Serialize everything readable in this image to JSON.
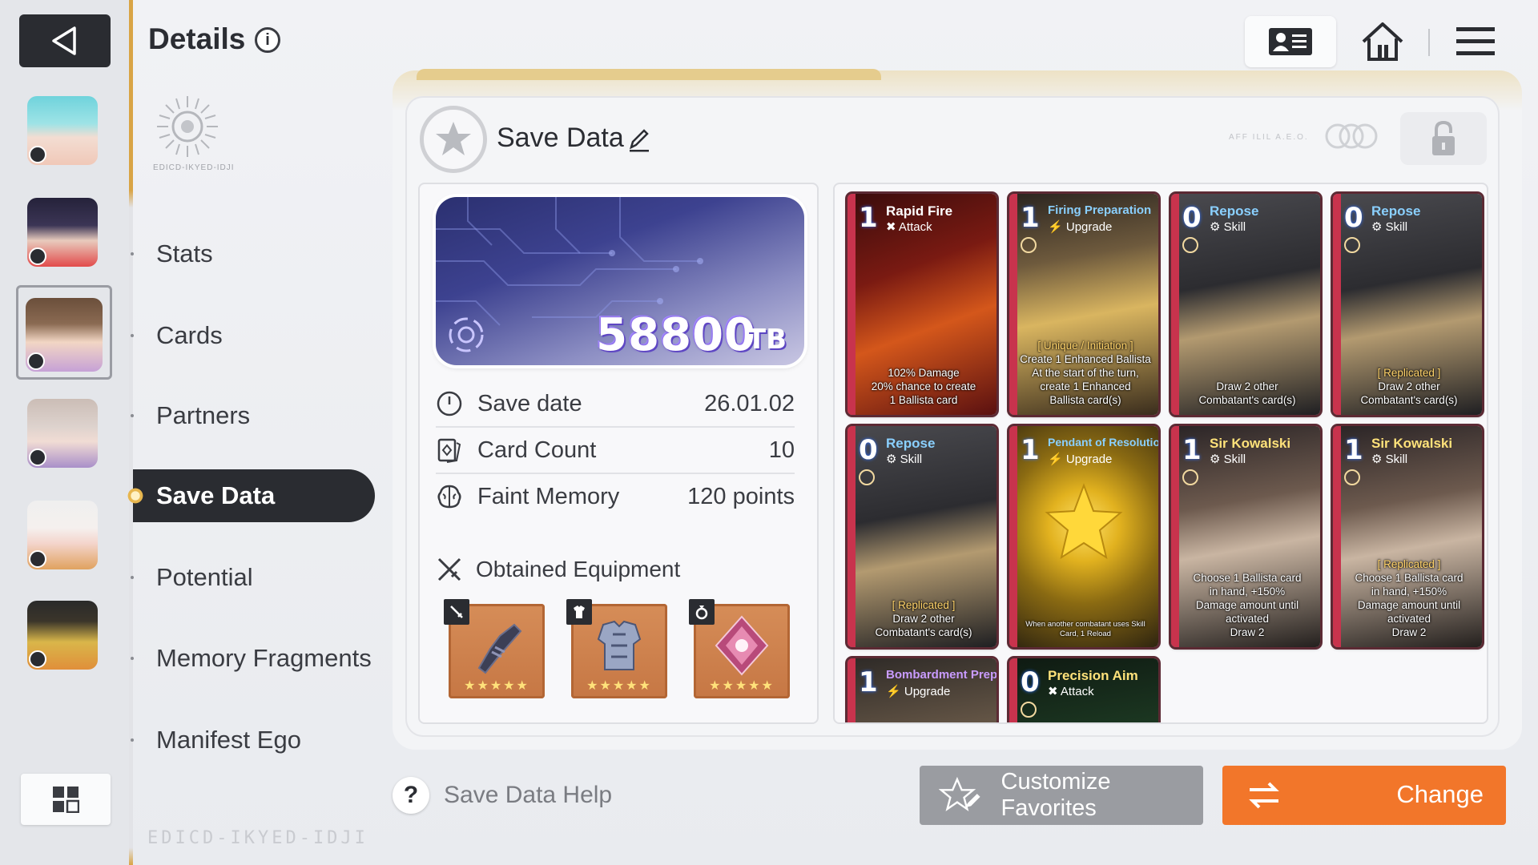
{
  "header": {
    "title": "Details"
  },
  "emblem_text": "EDICD-IKYED-IDJI",
  "footer_logo": "EDICD-IKYED-IDJI",
  "nav": [
    {
      "label": "Stats",
      "active": false
    },
    {
      "label": "Cards",
      "active": false
    },
    {
      "label": "Partners",
      "active": false
    },
    {
      "label": "Save Data",
      "active": true
    },
    {
      "label": "Potential",
      "active": false
    },
    {
      "label": "Memory Fragments",
      "active": false
    },
    {
      "label": "Manifest Ego",
      "active": false
    }
  ],
  "icons": {
    "back": "back-triangle-icon",
    "info": "info-icon",
    "profile": "id-card-icon",
    "home": "home-icon",
    "menu": "hamburger-menu-icon",
    "grid": "grid-icon",
    "lock": "lock-icon"
  },
  "save": {
    "title": "Save Data",
    "dots_text": "AFF ILIL A.E.O.",
    "tb_value": "58800",
    "tb_unit": "TB",
    "rows": [
      {
        "label": "Save date",
        "value": "26.01.02"
      },
      {
        "label": "Card Count",
        "value": "10"
      },
      {
        "label": "Faint Memory",
        "value": "120 points"
      }
    ],
    "equipment_title": "Obtained Equipment",
    "equipment": [
      {
        "slot": "weapon",
        "stars": "★★★★★"
      },
      {
        "slot": "armor",
        "stars": "★★★★★"
      },
      {
        "slot": "ring",
        "stars": "★★★★★"
      }
    ]
  },
  "cards": [
    {
      "cost": "1",
      "name": "Rapid Fire",
      "type": "Attack",
      "d1": "102% Damage",
      "d2": "20% chance to create",
      "d3": "1 Ballista card",
      "d4": "",
      "d5": ""
    },
    {
      "cost": "1",
      "name": "Firing Preparation",
      "type": "Upgrade",
      "d1": "[ Unique / Initiation ]",
      "d2": "Create 1 Enhanced Ballista",
      "d3": "At the start of the turn,",
      "d4": "create 1 Enhanced",
      "d5": "Ballista card(s)"
    },
    {
      "cost": "0",
      "name": "Repose",
      "type": "Skill",
      "d1": "",
      "d2": "Draw 2 other",
      "d3": "Combatant's card(s)",
      "d4": "",
      "d5": ""
    },
    {
      "cost": "0",
      "name": "Repose",
      "type": "Skill",
      "d1": "[ Replicated ]",
      "d2": "Draw 2 other",
      "d3": "Combatant's card(s)",
      "d4": "",
      "d5": ""
    },
    {
      "cost": "0",
      "name": "Repose",
      "type": "Skill",
      "d1": "[ Replicated ]",
      "d2": "Draw 2 other",
      "d3": "Combatant's card(s)",
      "d4": "",
      "d5": ""
    },
    {
      "cost": "1",
      "name": "Pendant of Resolution",
      "type": "Upgrade",
      "d1": "When another combatant uses Skill",
      "d2": "Card, 1 Reload",
      "d3": "",
      "d4": "",
      "d5": ""
    },
    {
      "cost": "1",
      "name": "Sir Kowalski",
      "type": "Skill",
      "d1": "",
      "d2": "Choose 1 Ballista card",
      "d3": "in hand, +150%",
      "d4": "Damage amount until activated",
      "d5": "Draw 2"
    },
    {
      "cost": "1",
      "name": "Sir Kowalski",
      "type": "Skill",
      "d1": "[ Replicated ]",
      "d2": "Choose 1 Ballista card",
      "d3": "in hand, +150%",
      "d4": "Damage amount until activated",
      "d5": "Draw 2"
    },
    {
      "cost": "1",
      "name": "Bombardment Prep",
      "type": "Upgrade",
      "d1": "",
      "d2": "",
      "d3": "",
      "d4": "",
      "d5": ""
    },
    {
      "cost": "0",
      "name": "Precision Aim",
      "type": "Attack",
      "d1": "",
      "d2": "",
      "d3": "",
      "d4": "",
      "d5": ""
    }
  ],
  "footer": {
    "help": "Save Data Help",
    "customize": "Customize Favorites",
    "change": "Change"
  }
}
